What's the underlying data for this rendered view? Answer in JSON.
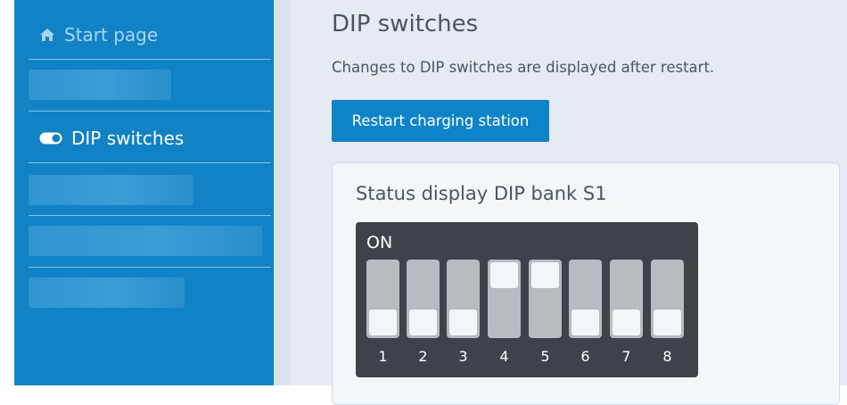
{
  "sidebar": {
    "items": [
      {
        "label": "Start page",
        "icon": "home-icon",
        "active": false
      },
      {
        "label": "DIP switches",
        "icon": "toggle-icon",
        "active": true
      }
    ]
  },
  "main": {
    "title": "DIP switches",
    "notice": "Changes to DIP switches are displayed after restart.",
    "restart_button": "Restart charging station",
    "card": {
      "title": "Status display DIP bank S1",
      "on_label": "ON",
      "switches": [
        {
          "number": "1",
          "state": "off"
        },
        {
          "number": "2",
          "state": "off"
        },
        {
          "number": "3",
          "state": "off"
        },
        {
          "number": "4",
          "state": "on"
        },
        {
          "number": "5",
          "state": "on"
        },
        {
          "number": "6",
          "state": "off"
        },
        {
          "number": "7",
          "state": "off"
        },
        {
          "number": "8",
          "state": "off"
        }
      ]
    }
  },
  "colors": {
    "sidebar": "#1182c6",
    "button": "#0f83c9",
    "background": "#e6ebf3",
    "dip_bank": "#3e4249"
  }
}
